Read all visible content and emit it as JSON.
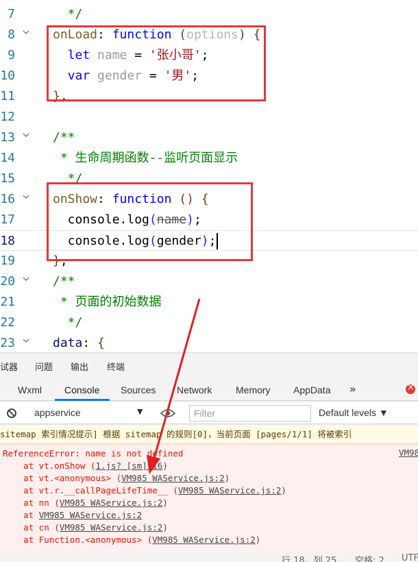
{
  "editor": {
    "lines": [
      {
        "num": "7",
        "fold": false,
        "segments": [
          {
            "t": "  */",
            "c": "t-comment"
          }
        ]
      },
      {
        "num": "8",
        "fold": true,
        "segments": [
          {
            "t": "onLoad",
            "c": "t-fn"
          },
          {
            "t": ": ",
            "c": "t-plain"
          },
          {
            "t": "function",
            "c": "t-key"
          },
          {
            "t": " ",
            "c": "t-plain"
          },
          {
            "t": "(",
            "c": "t-br2"
          },
          {
            "t": "options",
            "c": "t-param"
          },
          {
            "t": ")",
            "c": "t-br2"
          },
          {
            "t": " ",
            "c": "t-plain"
          },
          {
            "t": "{",
            "c": "t-br2"
          }
        ]
      },
      {
        "num": "9",
        "fold": false,
        "segments": [
          {
            "t": "  ",
            "c": "t-plain"
          },
          {
            "t": "let",
            "c": "t-kw"
          },
          {
            "t": " ",
            "c": "t-plain"
          },
          {
            "t": "name",
            "c": "t-unused"
          },
          {
            "t": " = ",
            "c": "t-plain"
          },
          {
            "t": "'张小哥'",
            "c": "t-str"
          },
          {
            "t": ";",
            "c": "t-plain"
          }
        ]
      },
      {
        "num": "10",
        "fold": false,
        "segments": [
          {
            "t": "  ",
            "c": "t-plain"
          },
          {
            "t": "var",
            "c": "t-kw"
          },
          {
            "t": " ",
            "c": "t-plain"
          },
          {
            "t": "gender",
            "c": "t-unused"
          },
          {
            "t": " = ",
            "c": "t-plain"
          },
          {
            "t": "'男'",
            "c": "t-str"
          },
          {
            "t": ";",
            "c": "t-plain"
          }
        ]
      },
      {
        "num": "11",
        "fold": false,
        "segments": [
          {
            "t": "}",
            "c": "t-br2"
          },
          {
            "t": ",",
            "c": "t-plain"
          }
        ]
      },
      {
        "num": "12",
        "fold": false,
        "segments": []
      },
      {
        "num": "13",
        "fold": true,
        "segments": [
          {
            "t": "/**",
            "c": "t-comment"
          }
        ]
      },
      {
        "num": "14",
        "fold": false,
        "segments": [
          {
            "t": " * 生命周期函数--监听页面显示",
            "c": "t-comment"
          }
        ]
      },
      {
        "num": "15",
        "fold": false,
        "segments": [
          {
            "t": "  */",
            "c": "t-comment"
          }
        ]
      },
      {
        "num": "16",
        "fold": true,
        "segments": [
          {
            "t": "onShow",
            "c": "t-fn"
          },
          {
            "t": ": ",
            "c": "t-plain"
          },
          {
            "t": "function",
            "c": "t-key"
          },
          {
            "t": " ",
            "c": "t-plain"
          },
          {
            "t": "()",
            "c": "t-br2"
          },
          {
            "t": " ",
            "c": "t-plain"
          },
          {
            "t": "{",
            "c": "t-br2"
          }
        ]
      },
      {
        "num": "17",
        "fold": false,
        "segments": [
          {
            "t": "  console",
            "c": "t-plain"
          },
          {
            "t": ".log",
            "c": "t-plain"
          },
          {
            "t": "(",
            "c": "t-br3"
          },
          {
            "t": "name",
            "c": "strike"
          },
          {
            "t": ")",
            "c": "t-br3"
          },
          {
            "t": ";",
            "c": "t-plain"
          }
        ]
      },
      {
        "num": "18",
        "fold": false,
        "current": true,
        "segments": [
          {
            "t": "  console",
            "c": "t-plain"
          },
          {
            "t": ".log",
            "c": "t-plain"
          },
          {
            "t": "(",
            "c": "t-br3"
          },
          {
            "t": "gender",
            "c": "t-plain"
          },
          {
            "t": ")",
            "c": "t-br3"
          },
          {
            "t": ";",
            "c": "t-plain"
          }
        ]
      },
      {
        "num": "19",
        "fold": false,
        "segments": [
          {
            "t": "}",
            "c": "t-br2"
          },
          {
            "t": ",",
            "c": "t-plain"
          }
        ]
      },
      {
        "num": "20",
        "fold": true,
        "segments": [
          {
            "t": "/**",
            "c": "t-comment"
          }
        ]
      },
      {
        "num": "21",
        "fold": false,
        "segments": [
          {
            "t": " * 页面的初始数据",
            "c": "t-comment"
          }
        ]
      },
      {
        "num": "22",
        "fold": false,
        "segments": [
          {
            "t": "  */",
            "c": "t-comment"
          }
        ]
      },
      {
        "num": "23",
        "fold": true,
        "segments": [
          {
            "t": "data",
            "c": "t-prop"
          },
          {
            "t": ": ",
            "c": "t-plain"
          },
          {
            "t": "{",
            "c": "t-br2"
          }
        ]
      }
    ]
  },
  "panel_tabs": [
    "试器",
    "问题",
    "输出",
    "终端"
  ],
  "devtools_tabs": [
    "Wxml",
    "Console",
    "Sources",
    "Network",
    "Memory",
    "AppData"
  ],
  "more_tabs_glyph": "»",
  "toolbar": {
    "context": "appservice",
    "filter_placeholder": "Filter",
    "levels": "Default levels ▼"
  },
  "sitemap_message": "sitemap 索引情况提示] 根据 sitemap 的规则[0]，当前页面 [pages/1/1] 将被索引",
  "error": {
    "source": "VM98",
    "lines": [
      {
        "pre": "ReferenceError: name is not defined",
        "link": "",
        "post": ""
      },
      {
        "pre": "    at vt.onShow (",
        "link": "1.js? [sm]:16",
        "post": ")"
      },
      {
        "pre": "    at vt.<anonymous> (",
        "link": "VM985 WAService.js:2",
        "post": ")"
      },
      {
        "pre": "    at vt.r.__callPageLifeTime__ (",
        "link": "VM985 WAService.js:2",
        "post": ")"
      },
      {
        "pre": "    at nn (",
        "link": "VM985 WAService.js:2",
        "post": ")"
      },
      {
        "pre": "    at ",
        "link": "VM985 WAService.js:2",
        "post": ""
      },
      {
        "pre": "    at cn (",
        "link": "VM985 WAService.js:2",
        "post": ")"
      },
      {
        "pre": "    at Function.<anonymous> (",
        "link": "VM985 WAService.js:2",
        "post": ")"
      }
    ]
  },
  "statusbar": {
    "position": "行 18，列 25",
    "spaces": "空格: 2",
    "encoding": "UTF"
  },
  "colors": {
    "highlight_box": "#e03a3a",
    "error_text": "#e51400",
    "console_tab_accent": "#1a73e8"
  }
}
